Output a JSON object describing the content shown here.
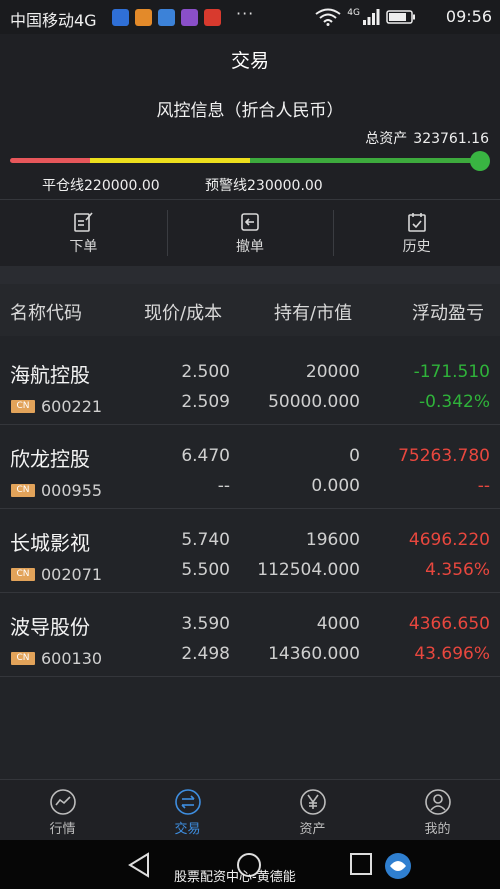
{
  "status_bar": {
    "carrier": "中国移动4G",
    "dots": "···",
    "network": "4G",
    "time": "09:56"
  },
  "header": {
    "title": "交易"
  },
  "risk": {
    "title": "风控信息（折合人民币）",
    "total_assets_label": "总资产",
    "total_assets_value": "323761.16",
    "liquidation_line": "平仓线220000.00",
    "warning_line": "预警线230000.00"
  },
  "actions": [
    {
      "label": "下单",
      "icon": "order-icon"
    },
    {
      "label": "撤单",
      "icon": "cancel-order-icon"
    },
    {
      "label": "历史",
      "icon": "history-icon"
    }
  ],
  "table": {
    "headers": [
      "名称代码",
      "现价/成本",
      "持有/市值",
      "浮动盈亏"
    ],
    "rows": [
      {
        "name": "海航控股",
        "market": "CN",
        "code": "600221",
        "price": "2.500",
        "cost": "2.509",
        "holding": "20000",
        "market_value": "50000.000",
        "pl": "-171.510",
        "pl_pct": "-0.342%",
        "direction": "down"
      },
      {
        "name": "欣龙控股",
        "market": "CN",
        "code": "000955",
        "price": "6.470",
        "cost": "--",
        "holding": "0",
        "market_value": "0.000",
        "pl": "75263.780",
        "pl_pct": "--",
        "direction": "up"
      },
      {
        "name": "长城影视",
        "market": "CN",
        "code": "002071",
        "price": "5.740",
        "cost": "5.500",
        "holding": "19600",
        "market_value": "112504.000",
        "pl": "4696.220",
        "pl_pct": "4.356%",
        "direction": "up"
      },
      {
        "name": "波导股份",
        "market": "CN",
        "code": "600130",
        "price": "3.590",
        "cost": "2.498",
        "holding": "4000",
        "market_value": "14360.000",
        "pl": "4366.650",
        "pl_pct": "43.696%",
        "direction": "up"
      }
    ]
  },
  "tabs": [
    {
      "label": "行情",
      "icon": "market-chart-icon",
      "active": false
    },
    {
      "label": "交易",
      "icon": "trade-icon",
      "active": true
    },
    {
      "label": "资产",
      "icon": "yen-icon",
      "active": false
    },
    {
      "label": "我的",
      "icon": "user-icon",
      "active": false
    }
  ],
  "watermark": "股票配资中心-黄德能",
  "colors": {
    "up": "#e8473e",
    "down": "#2fb33a",
    "active_tab": "#3e8ee0",
    "background": "#222428"
  }
}
